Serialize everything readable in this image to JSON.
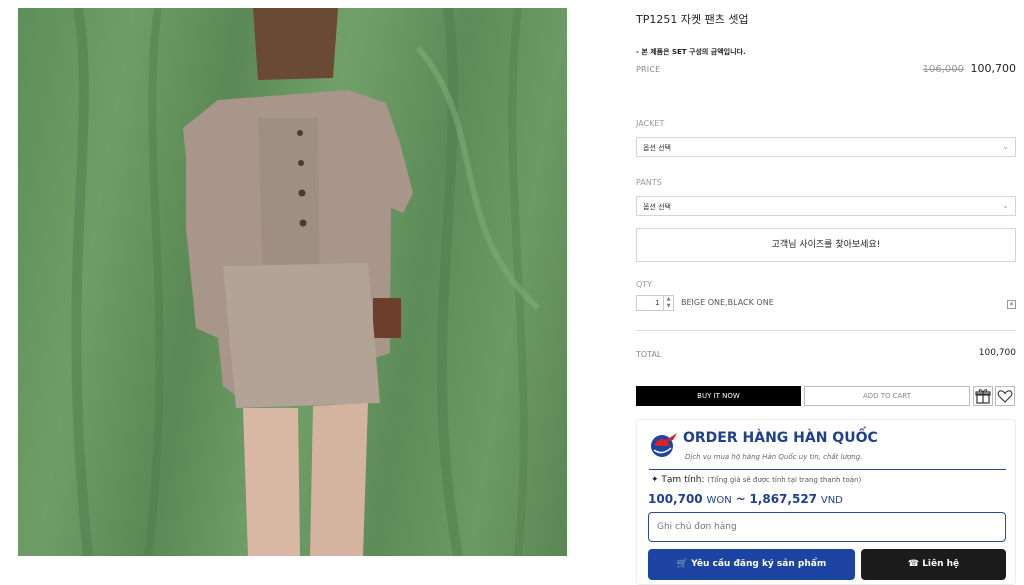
{
  "product": {
    "title": "TP1251 자켓 팬츠 셋업",
    "set_note": "- 본 제품은 SET 구성의 금액입니다.",
    "price_label": "PRICE",
    "price_old": "106,000",
    "price_new": "100,700"
  },
  "options": [
    {
      "label": "JACKET",
      "selected": "옵션 선택"
    },
    {
      "label": "PANTS",
      "selected": "옵션 선택"
    }
  ],
  "size_button": "고객님 사이즈를 찾아보세요!",
  "quantity": {
    "label": "QTY",
    "value": "1",
    "variant": "BEIGE ONE,BLACK ONE"
  },
  "total": {
    "label": "TOTAL",
    "value": "100,700"
  },
  "actions": {
    "buy_now": "BUY IT NOW",
    "add_to_cart": "ADD TO CART"
  },
  "order_widget": {
    "title": "ORDER HÀNG HÀN QUỐC",
    "subtitle": "Dịch vụ mua hộ hàng Hàn Quốc uy tín, chất lượng.",
    "estimate_label": "Tạm tính:",
    "estimate_note": "(Tổng giá sẽ được tính tại trang thanh toán)",
    "won_amount": "100,700",
    "won_unit": "WON",
    "separator": "~",
    "vnd_amount": "1,867,527",
    "vnd_unit": "VND",
    "note_placeholder": "Ghi chú đơn hàng",
    "request_button": "Yêu cầu đăng ký sản phẩm",
    "contact_button": "Liên hệ"
  },
  "icons": {
    "dropdown": "chevron-down-icon",
    "remove": "close-icon",
    "gift": "gift-icon",
    "wishlist": "heart-icon",
    "cart": "cart-icon",
    "phone": "phone-icon",
    "logo": "airplane-logo-icon"
  },
  "colors": {
    "brand_blue": "#1e44a3",
    "brand_red": "#d8232a",
    "dark_button": "#1c1c1c",
    "buy_button": "#000000"
  }
}
